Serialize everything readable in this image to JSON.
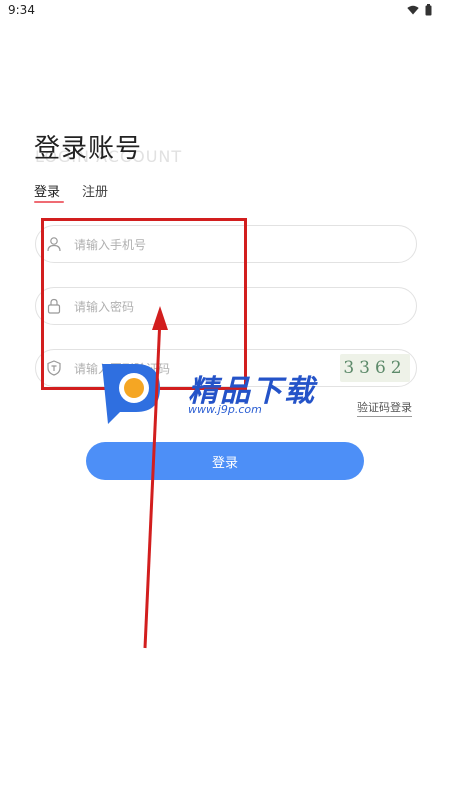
{
  "status_bar": {
    "time": "9:34"
  },
  "header": {
    "title": "登录账号",
    "subtitle": "LOGIN ACCOUNT"
  },
  "tabs": [
    {
      "label": "登录",
      "active": true
    },
    {
      "label": "注册",
      "active": false
    }
  ],
  "form": {
    "phone": {
      "placeholder": "请输入手机号",
      "value": ""
    },
    "password": {
      "placeholder": "请输入密码",
      "value": ""
    },
    "captcha": {
      "placeholder": "请输入图形验证码",
      "value": "",
      "image_text": "3362"
    },
    "sms_login_label": "验证码登录",
    "submit_label": "登录"
  },
  "watermark": {
    "brand": "精品下载",
    "url": "www.j9p.com"
  },
  "colors": {
    "primary": "#4d8ff7",
    "tab_underline": "#ef6b73",
    "annotation": "#d21e1e"
  }
}
